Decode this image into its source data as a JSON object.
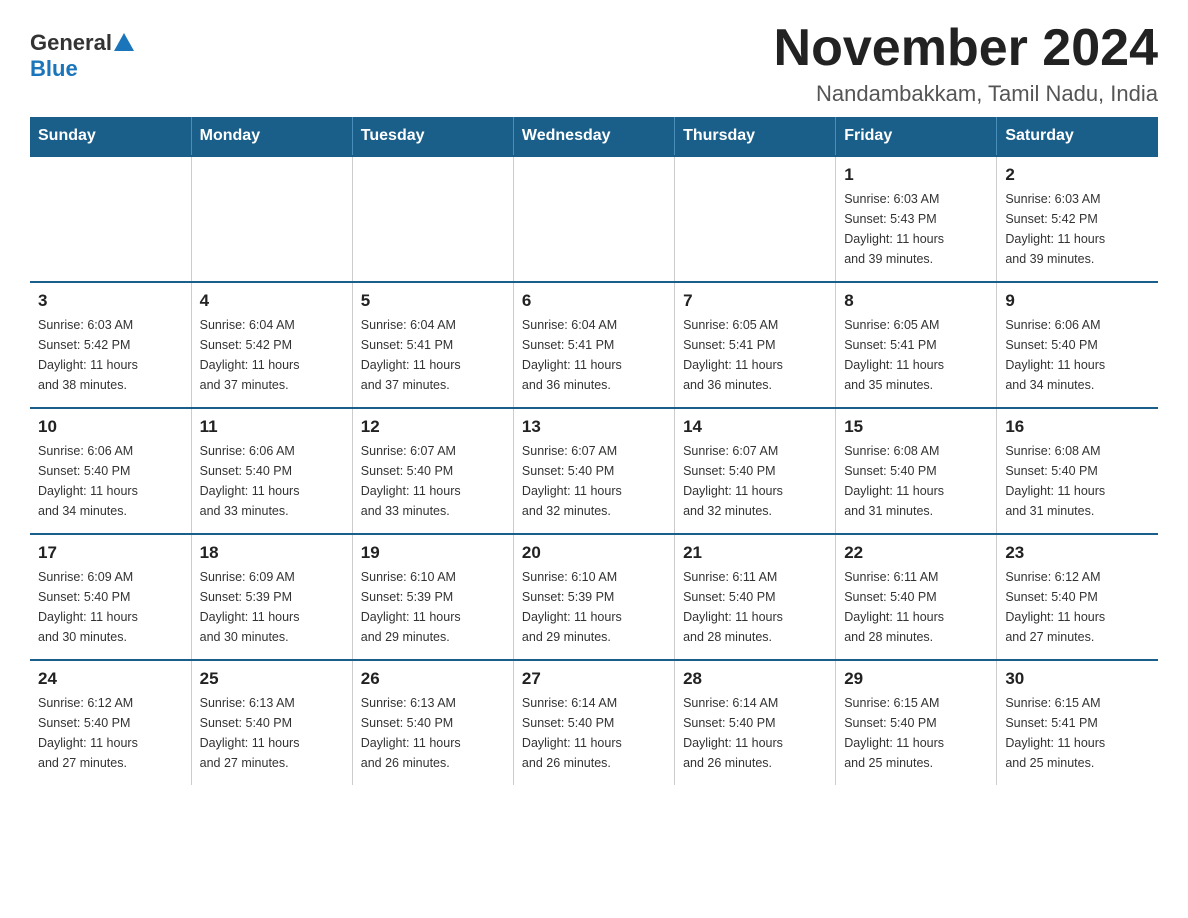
{
  "logo": {
    "general": "General",
    "blue": "Blue"
  },
  "title": "November 2024",
  "location": "Nandambakkam, Tamil Nadu, India",
  "days_of_week": [
    "Sunday",
    "Monday",
    "Tuesday",
    "Wednesday",
    "Thursday",
    "Friday",
    "Saturday"
  ],
  "weeks": [
    [
      {
        "day": "",
        "info": ""
      },
      {
        "day": "",
        "info": ""
      },
      {
        "day": "",
        "info": ""
      },
      {
        "day": "",
        "info": ""
      },
      {
        "day": "",
        "info": ""
      },
      {
        "day": "1",
        "info": "Sunrise: 6:03 AM\nSunset: 5:43 PM\nDaylight: 11 hours\nand 39 minutes."
      },
      {
        "day": "2",
        "info": "Sunrise: 6:03 AM\nSunset: 5:42 PM\nDaylight: 11 hours\nand 39 minutes."
      }
    ],
    [
      {
        "day": "3",
        "info": "Sunrise: 6:03 AM\nSunset: 5:42 PM\nDaylight: 11 hours\nand 38 minutes."
      },
      {
        "day": "4",
        "info": "Sunrise: 6:04 AM\nSunset: 5:42 PM\nDaylight: 11 hours\nand 37 minutes."
      },
      {
        "day": "5",
        "info": "Sunrise: 6:04 AM\nSunset: 5:41 PM\nDaylight: 11 hours\nand 37 minutes."
      },
      {
        "day": "6",
        "info": "Sunrise: 6:04 AM\nSunset: 5:41 PM\nDaylight: 11 hours\nand 36 minutes."
      },
      {
        "day": "7",
        "info": "Sunrise: 6:05 AM\nSunset: 5:41 PM\nDaylight: 11 hours\nand 36 minutes."
      },
      {
        "day": "8",
        "info": "Sunrise: 6:05 AM\nSunset: 5:41 PM\nDaylight: 11 hours\nand 35 minutes."
      },
      {
        "day": "9",
        "info": "Sunrise: 6:06 AM\nSunset: 5:40 PM\nDaylight: 11 hours\nand 34 minutes."
      }
    ],
    [
      {
        "day": "10",
        "info": "Sunrise: 6:06 AM\nSunset: 5:40 PM\nDaylight: 11 hours\nand 34 minutes."
      },
      {
        "day": "11",
        "info": "Sunrise: 6:06 AM\nSunset: 5:40 PM\nDaylight: 11 hours\nand 33 minutes."
      },
      {
        "day": "12",
        "info": "Sunrise: 6:07 AM\nSunset: 5:40 PM\nDaylight: 11 hours\nand 33 minutes."
      },
      {
        "day": "13",
        "info": "Sunrise: 6:07 AM\nSunset: 5:40 PM\nDaylight: 11 hours\nand 32 minutes."
      },
      {
        "day": "14",
        "info": "Sunrise: 6:07 AM\nSunset: 5:40 PM\nDaylight: 11 hours\nand 32 minutes."
      },
      {
        "day": "15",
        "info": "Sunrise: 6:08 AM\nSunset: 5:40 PM\nDaylight: 11 hours\nand 31 minutes."
      },
      {
        "day": "16",
        "info": "Sunrise: 6:08 AM\nSunset: 5:40 PM\nDaylight: 11 hours\nand 31 minutes."
      }
    ],
    [
      {
        "day": "17",
        "info": "Sunrise: 6:09 AM\nSunset: 5:40 PM\nDaylight: 11 hours\nand 30 minutes."
      },
      {
        "day": "18",
        "info": "Sunrise: 6:09 AM\nSunset: 5:39 PM\nDaylight: 11 hours\nand 30 minutes."
      },
      {
        "day": "19",
        "info": "Sunrise: 6:10 AM\nSunset: 5:39 PM\nDaylight: 11 hours\nand 29 minutes."
      },
      {
        "day": "20",
        "info": "Sunrise: 6:10 AM\nSunset: 5:39 PM\nDaylight: 11 hours\nand 29 minutes."
      },
      {
        "day": "21",
        "info": "Sunrise: 6:11 AM\nSunset: 5:40 PM\nDaylight: 11 hours\nand 28 minutes."
      },
      {
        "day": "22",
        "info": "Sunrise: 6:11 AM\nSunset: 5:40 PM\nDaylight: 11 hours\nand 28 minutes."
      },
      {
        "day": "23",
        "info": "Sunrise: 6:12 AM\nSunset: 5:40 PM\nDaylight: 11 hours\nand 27 minutes."
      }
    ],
    [
      {
        "day": "24",
        "info": "Sunrise: 6:12 AM\nSunset: 5:40 PM\nDaylight: 11 hours\nand 27 minutes."
      },
      {
        "day": "25",
        "info": "Sunrise: 6:13 AM\nSunset: 5:40 PM\nDaylight: 11 hours\nand 27 minutes."
      },
      {
        "day": "26",
        "info": "Sunrise: 6:13 AM\nSunset: 5:40 PM\nDaylight: 11 hours\nand 26 minutes."
      },
      {
        "day": "27",
        "info": "Sunrise: 6:14 AM\nSunset: 5:40 PM\nDaylight: 11 hours\nand 26 minutes."
      },
      {
        "day": "28",
        "info": "Sunrise: 6:14 AM\nSunset: 5:40 PM\nDaylight: 11 hours\nand 26 minutes."
      },
      {
        "day": "29",
        "info": "Sunrise: 6:15 AM\nSunset: 5:40 PM\nDaylight: 11 hours\nand 25 minutes."
      },
      {
        "day": "30",
        "info": "Sunrise: 6:15 AM\nSunset: 5:41 PM\nDaylight: 11 hours\nand 25 minutes."
      }
    ]
  ]
}
